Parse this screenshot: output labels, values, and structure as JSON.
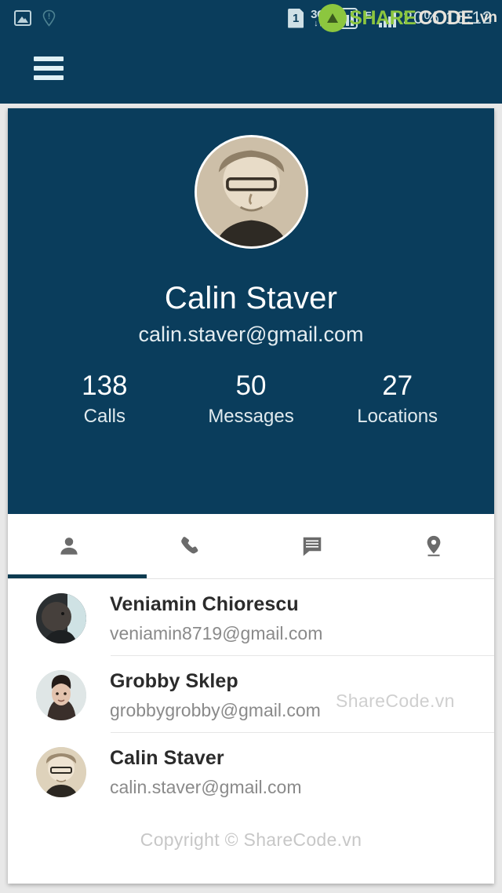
{
  "statusbar": {
    "left_icons": [
      {
        "name": "screenshot-icon",
        "label": "image"
      },
      {
        "name": "location-alert-icon",
        "label": "pin"
      }
    ],
    "sim_number": "1",
    "network_label": "3G",
    "network_arrows": "↓↑",
    "edge_label": "E",
    "clock_battery": "20%  16:12",
    "watermark": {
      "share": "SHARE",
      "code": "CODE",
      "tld": ".vn"
    }
  },
  "appbar": {
    "menu_label": "Menu"
  },
  "profile": {
    "name": "Calin Staver",
    "email": "calin.staver@gmail.com",
    "stats": [
      {
        "value": "138",
        "label": "Calls"
      },
      {
        "value": "50",
        "label": "Messages"
      },
      {
        "value": "27",
        "label": "Locations"
      }
    ]
  },
  "tabs": [
    {
      "name": "tab-contacts",
      "icon": "person-icon",
      "active": true
    },
    {
      "name": "tab-calls",
      "icon": "phone-icon",
      "active": false
    },
    {
      "name": "tab-messages",
      "icon": "message-icon",
      "active": false
    },
    {
      "name": "tab-locations",
      "icon": "location-pin-icon",
      "active": false
    }
  ],
  "contacts": [
    {
      "name": "Veniamin Chiorescu",
      "email": "veniamin8719@gmail.com"
    },
    {
      "name": "Grobby Sklep",
      "email": "grobbygrobby@gmail.com"
    },
    {
      "name": "Calin Staver",
      "email": "calin.staver@gmail.com"
    }
  ],
  "list_watermark": "ShareCode.vn",
  "footer": {
    "copyright": "Copyright © ShareCode.vn"
  },
  "colors": {
    "brand_dark": "#0a3d5c",
    "accent_green": "#8cc63f",
    "card_bg": "#ffffff",
    "page_bg": "#e8e8e8"
  }
}
